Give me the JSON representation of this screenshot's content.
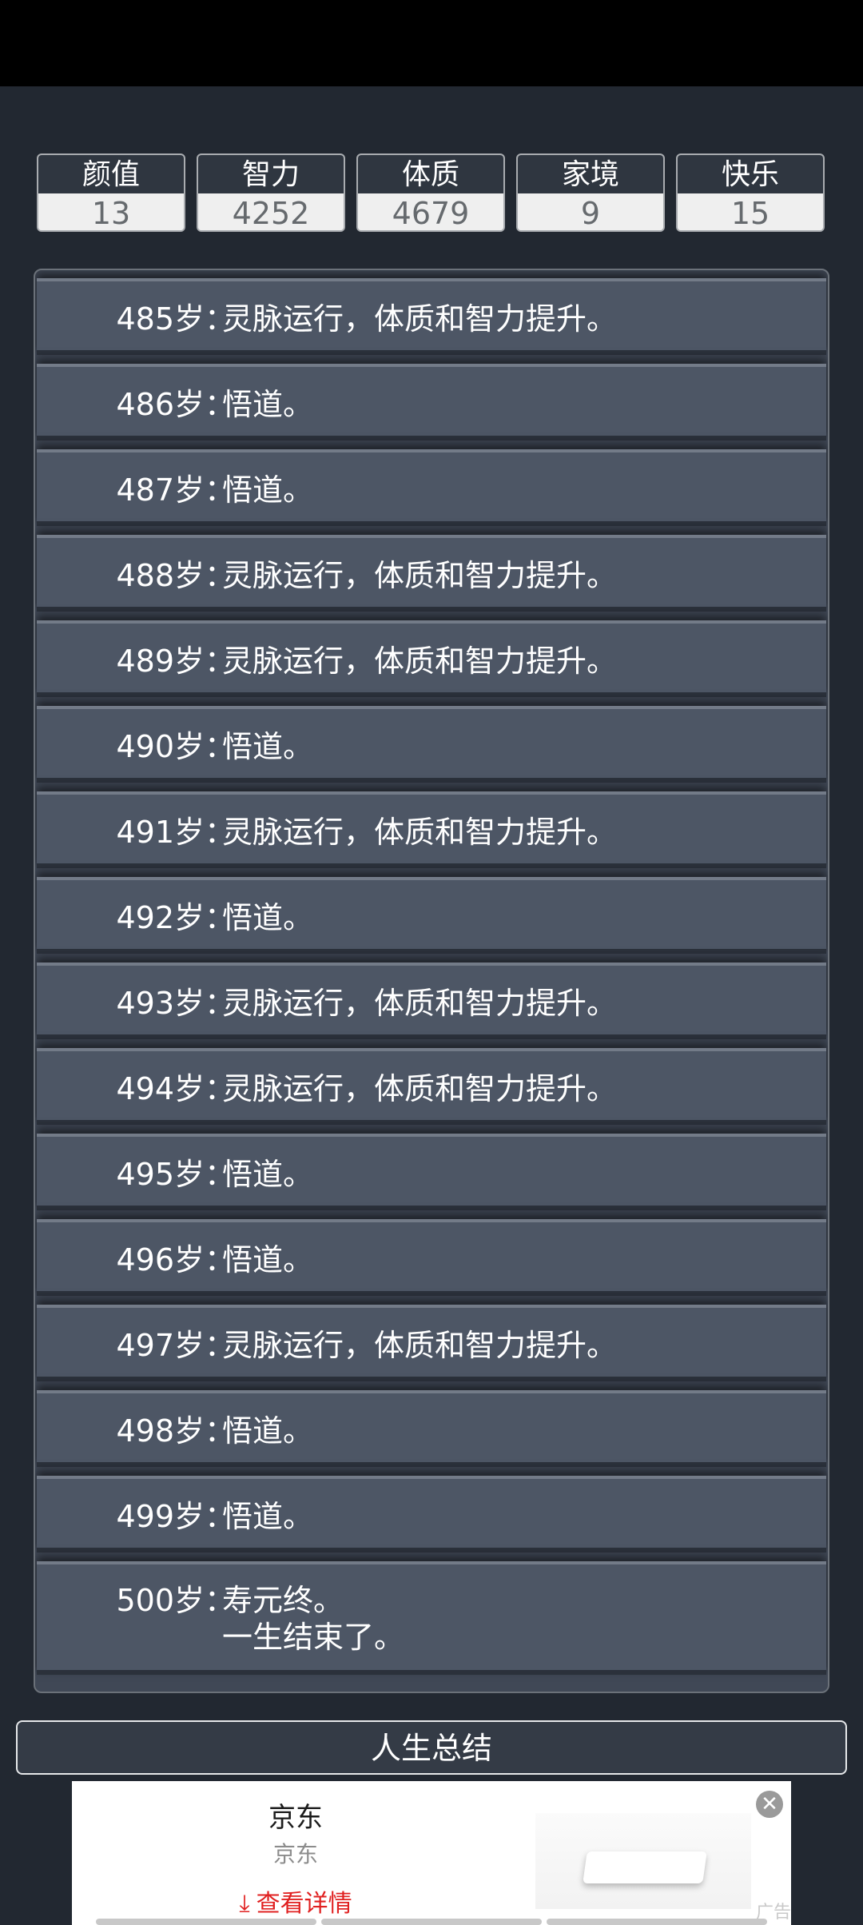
{
  "stats": [
    {
      "label": "颜值",
      "value": "13"
    },
    {
      "label": "智力",
      "value": "4252"
    },
    {
      "label": "体质",
      "value": "4679"
    },
    {
      "label": "家境",
      "value": "9"
    },
    {
      "label": "快乐",
      "value": "15"
    }
  ],
  "log": {
    "colon": "：",
    "rows": [
      {
        "age": "485岁",
        "event": "灵脉运行，体质和智力提升。"
      },
      {
        "age": "486岁",
        "event": "悟道。"
      },
      {
        "age": "487岁",
        "event": "悟道。"
      },
      {
        "age": "488岁",
        "event": "灵脉运行，体质和智力提升。"
      },
      {
        "age": "489岁",
        "event": "灵脉运行，体质和智力提升。"
      },
      {
        "age": "490岁",
        "event": "悟道。"
      },
      {
        "age": "491岁",
        "event": "灵脉运行，体质和智力提升。"
      },
      {
        "age": "492岁",
        "event": "悟道。"
      },
      {
        "age": "493岁",
        "event": "灵脉运行，体质和智力提升。"
      },
      {
        "age": "494岁",
        "event": "灵脉运行，体质和智力提升。"
      },
      {
        "age": "495岁",
        "event": "悟道。"
      },
      {
        "age": "496岁",
        "event": "悟道。"
      },
      {
        "age": "497岁",
        "event": "灵脉运行，体质和智力提升。"
      },
      {
        "age": "498岁",
        "event": "悟道。"
      },
      {
        "age": "499岁",
        "event": "悟道。"
      },
      {
        "age": "500岁",
        "event": "寿元终。\n一生结束了。"
      }
    ]
  },
  "summary_button": "人生总结",
  "ad": {
    "title": "京东",
    "subtitle": "京东",
    "cta": "查看详情",
    "tag": "广告",
    "close_icon": "close-icon",
    "arrow_icon": "download-arrow-icon"
  },
  "colors": {
    "background": "#222831",
    "row": "#4d5665",
    "accent_red": "#e02020"
  }
}
